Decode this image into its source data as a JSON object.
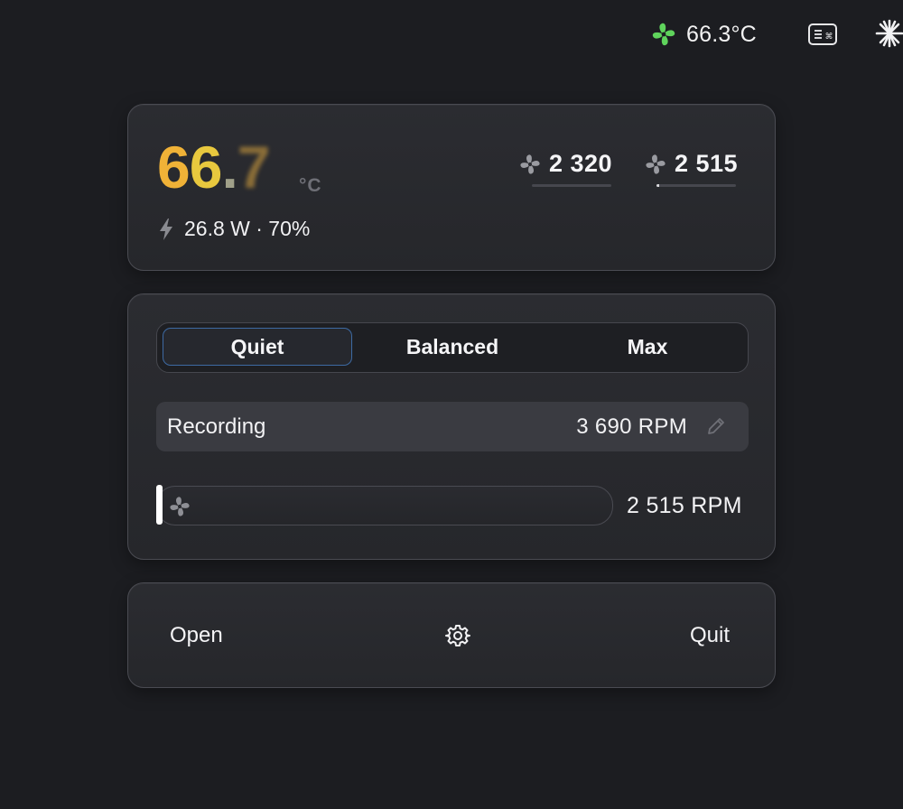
{
  "menubar": {
    "temp_text": "66.3°C",
    "fan_icon": "fan-icon",
    "fan_icon_color": "#5fd45c",
    "keyboard_icon": "keyboard-shortcut-icon",
    "spark_icon": "sparkle-icon"
  },
  "temperature": {
    "digit1": "6",
    "digit2": "6",
    "dot": ".",
    "digit3": "7",
    "unit": "°C",
    "power_icon": "lightning-icon",
    "power_text": "26.8 W · 70%"
  },
  "fans": [
    {
      "icon": "fan-icon",
      "rpm": "2 320",
      "level": 0.0
    },
    {
      "icon": "fan-icon",
      "rpm": "2 515",
      "level": 0.03
    }
  ],
  "modes": {
    "options": [
      "Quiet",
      "Balanced",
      "Max"
    ],
    "selected": "Quiet"
  },
  "recording": {
    "label": "Recording",
    "value": "3 690 RPM",
    "edit_icon": "pencil-icon"
  },
  "slider": {
    "icon": "fan-icon",
    "value_text": "2 515 RPM",
    "level": 0.0
  },
  "actions": {
    "open_label": "Open",
    "settings_icon": "gear-icon",
    "quit_label": "Quit"
  },
  "colors": {
    "background": "#1c1d21",
    "card": "#2a2b30",
    "accent_selection": "#3d6aa3",
    "temp_gradient_start": "#f0b237",
    "temp_gradient_end": "#e8c83e"
  }
}
